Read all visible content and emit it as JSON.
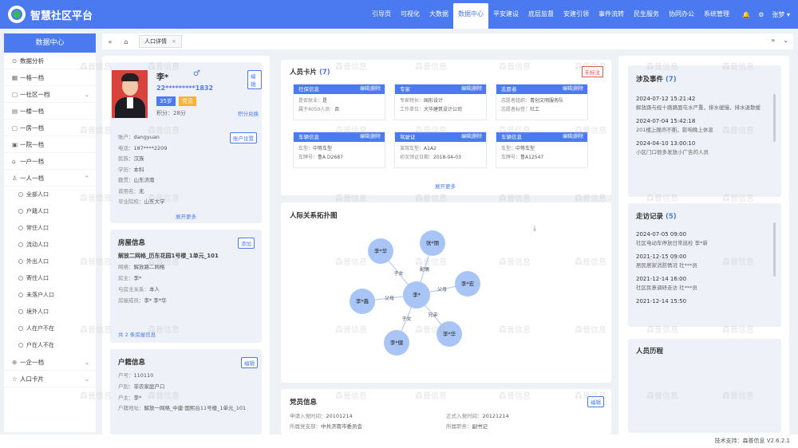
{
  "app": {
    "title": "智慧社区平台"
  },
  "topnav": [
    "引导页",
    "可视化",
    "大数据",
    "数据中心",
    "平安建设",
    "底层监督",
    "安建引领",
    "事件流转",
    "民生服务",
    "协同办公",
    "系统管理"
  ],
  "topnav_active": 3,
  "top_right": {
    "user": "张梦"
  },
  "sidebar": {
    "header": "数据中心",
    "items": [
      {
        "label": "数据分析",
        "icon": "chart-icon"
      },
      {
        "label": "一格一档",
        "icon": "grid-icon"
      },
      {
        "label": "一社区一档",
        "icon": "community-icon",
        "chev": "⌄"
      },
      {
        "label": "一楼一档",
        "icon": "building-icon"
      },
      {
        "label": "一房一档",
        "icon": "house-icon"
      },
      {
        "label": "一院一档",
        "icon": "yard-icon"
      },
      {
        "label": "一户一档",
        "icon": "household-icon"
      },
      {
        "label": "一人一档",
        "icon": "person-icon",
        "chev": "⌃"
      }
    ],
    "subitems": [
      "全部人口",
      "户籍人口",
      "常住人口",
      "流动人口",
      "外出人口",
      "寄住人口",
      "未落户人口",
      "境外人口",
      "人在户不在",
      "户在人不在"
    ],
    "bottom": [
      {
        "label": "一企一档",
        "icon": "enterprise-icon",
        "chev": "⌄"
      },
      {
        "label": "人口卡片",
        "icon": "card-icon",
        "chev": "⌄"
      }
    ]
  },
  "tabs": {
    "active": "人口详情"
  },
  "profile": {
    "name": "李*",
    "id": "22*********1832",
    "age": "35岁",
    "tag": "党员",
    "points_label": "积分：",
    "points": "28分",
    "points_link": "积分兑换",
    "edit": "编辑",
    "account_btn": "账户设置",
    "fields": [
      {
        "k": "账户：",
        "v": "dangyuan"
      },
      {
        "k": "电话：",
        "v": "187****2209"
      },
      {
        "k": "民族：",
        "v": "汉族"
      },
      {
        "k": "学历：",
        "v": "本科"
      },
      {
        "k": "籍贯：",
        "v": "山东济南"
      },
      {
        "k": "曾用名：",
        "v": "无"
      },
      {
        "k": "毕业院校：",
        "v": "山东大学"
      }
    ],
    "expand": "展开更多"
  },
  "house": {
    "title": "房屋信息",
    "add": "添加",
    "address": "解放二网格_历东花园1号楼_1单元_101",
    "fields": [
      {
        "k": "网格：",
        "v": "解放路二网格"
      },
      {
        "k": "房主：",
        "v": "李*"
      },
      {
        "k": "与房主关系：",
        "v": "本人"
      },
      {
        "k": "房屋成员：",
        "v": "李* 李*华"
      }
    ],
    "more": "共 2 条房屋信息"
  },
  "huji": {
    "title": "户籍信息",
    "edit": "编辑",
    "fields": [
      {
        "k": "户号：",
        "v": "110110"
      },
      {
        "k": "户别：",
        "v": "非农家庭户口"
      },
      {
        "k": "户主：",
        "v": "李*"
      },
      {
        "k": "户籍地址：",
        "v": "解放一网格_中建·国熙台11号楼_1单元_101"
      }
    ]
  },
  "person_cards": {
    "title": "人员卡片",
    "count": "(7)",
    "unmarked": "未标注",
    "action": "编辑|删除",
    "more": "展开更多",
    "cards": [
      {
        "title": "社保信息",
        "rows": [
          {
            "k": "是否就业：",
            "v": "是"
          },
          {
            "k": "属于4050人员：",
            "v": "否"
          }
        ]
      },
      {
        "title": "专家",
        "rows": [
          {
            "k": "专家特长：",
            "v": "国形设计"
          },
          {
            "k": "工作单位：",
            "v": "大华建筑设计公司"
          }
        ]
      },
      {
        "title": "志愿者",
        "rows": [
          {
            "k": "志愿者组织：",
            "v": "青创文明服务队"
          },
          {
            "k": "志愿者标签：",
            "v": "社工"
          }
        ]
      },
      {
        "title": "车辆信息",
        "rows": [
          {
            "k": "车型：",
            "v": "中等车型"
          },
          {
            "k": "车牌号：",
            "v": "鲁A D2687"
          }
        ]
      },
      {
        "title": "驾驶证",
        "rows": [
          {
            "k": "准驾车型：",
            "v": "A1A2"
          },
          {
            "k": "初次领证日期：",
            "v": "2018-04-03"
          }
        ]
      },
      {
        "title": "车辆信息",
        "rows": [
          {
            "k": "车型：",
            "v": "中等车型"
          },
          {
            "k": "车牌号：",
            "v": "鲁A12547"
          }
        ]
      }
    ]
  },
  "graph": {
    "title": "人际关系拓扑图",
    "center": "李*",
    "nodes": [
      {
        "label": "李*华",
        "rel": "子女"
      },
      {
        "label": "张*丽",
        "rel": "配偶"
      },
      {
        "label": "李*宏",
        "rel": "父母"
      },
      {
        "label": "李*鑫",
        "rel": "父母"
      },
      {
        "label": "李*华",
        "rel": "兄弟"
      },
      {
        "label": "李*健",
        "rel": "子女"
      }
    ]
  },
  "party": {
    "title": "党员信息",
    "edit": "编辑",
    "fields": [
      {
        "k": "申请入党时间：",
        "v": "20101214"
      },
      {
        "k": "正式入党时间：",
        "v": "20121214"
      },
      {
        "k": "所属党支部：",
        "v": "中共济南市委员会"
      },
      {
        "k": "所属职务：",
        "v": "副书记"
      }
    ]
  },
  "events": {
    "title": "涉及事件",
    "count": "(7)",
    "items": [
      {
        "time": "2024-07-12 15:21:42",
        "desc": "解放路与经十路路面屯水严重，排水缓慢，排水退散缓"
      },
      {
        "time": "2024-07-04 15:42:18",
        "desc": "201楼上噪声不断，影响晚上休息"
      },
      {
        "time": "2024-04-10 13:00:10",
        "desc": "小区门口很多发放小广告的人员"
      }
    ]
  },
  "visits": {
    "title": "走访记录",
    "count": "(5)",
    "items": [
      {
        "time": "2024-07-05 09:00",
        "desc": "社区电动车停放日常巡检  李*新"
      },
      {
        "time": "2021-12-15 09:00",
        "desc": "居民居家消防情况  社***员"
      },
      {
        "time": "2021-12-14 16:00",
        "desc": "社区民意调研走访  社***员"
      },
      {
        "time": "2021-12-14 15:50",
        "desc": ""
      }
    ]
  },
  "history": {
    "title": "人员历程"
  },
  "footer": {
    "text": "技术支持：森普信息  V2.6.2.1"
  },
  "watermark": "森普信息"
}
